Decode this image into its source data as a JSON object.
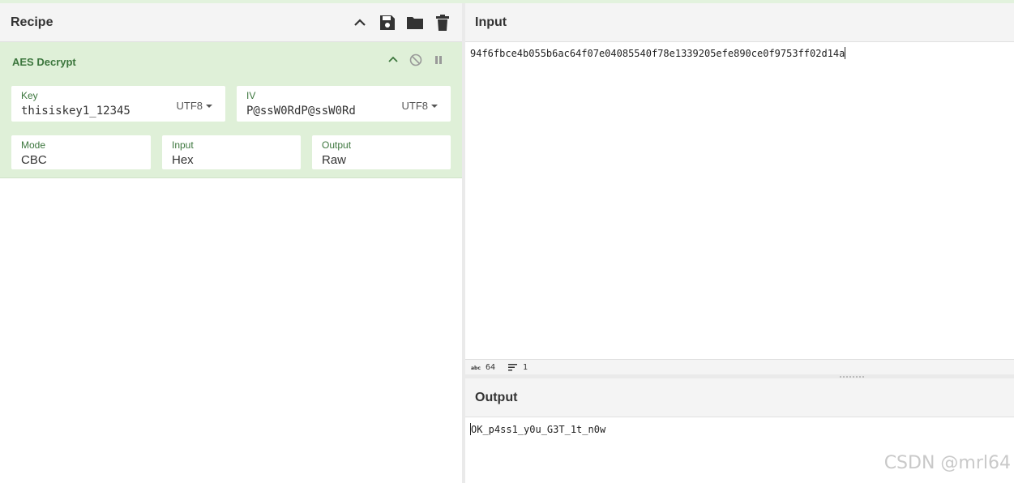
{
  "recipe": {
    "title": "Recipe",
    "icons": [
      "chevron-up-icon",
      "save-icon",
      "folder-icon",
      "trash-icon"
    ]
  },
  "operation": {
    "title": "AES Decrypt",
    "key": {
      "label": "Key",
      "value": "thisiskey1_12345",
      "encoding": "UTF8"
    },
    "iv": {
      "label": "IV",
      "value": "P@ssW0RdP@ssW0Rd",
      "encoding": "UTF8"
    },
    "mode": {
      "label": "Mode",
      "value": "CBC"
    },
    "input": {
      "label": "Input",
      "value": "Hex"
    },
    "output": {
      "label": "Output",
      "value": "Raw"
    }
  },
  "input_panel": {
    "title": "Input",
    "text": "94f6fbce4b055b6ac64f07e04085540f78e1339205efe890ce0f9753ff02d14a",
    "status": {
      "chars": "64",
      "lines": "1"
    }
  },
  "output_panel": {
    "title": "Output",
    "text": "OK_p4ss1_y0u_G3T_1t_n0w"
  },
  "watermark": "CSDN @mrl64",
  "colors": {
    "accent_green": "#3c763d",
    "op_bg": "#dff0d8",
    "header_bg": "#f4f4f4"
  }
}
